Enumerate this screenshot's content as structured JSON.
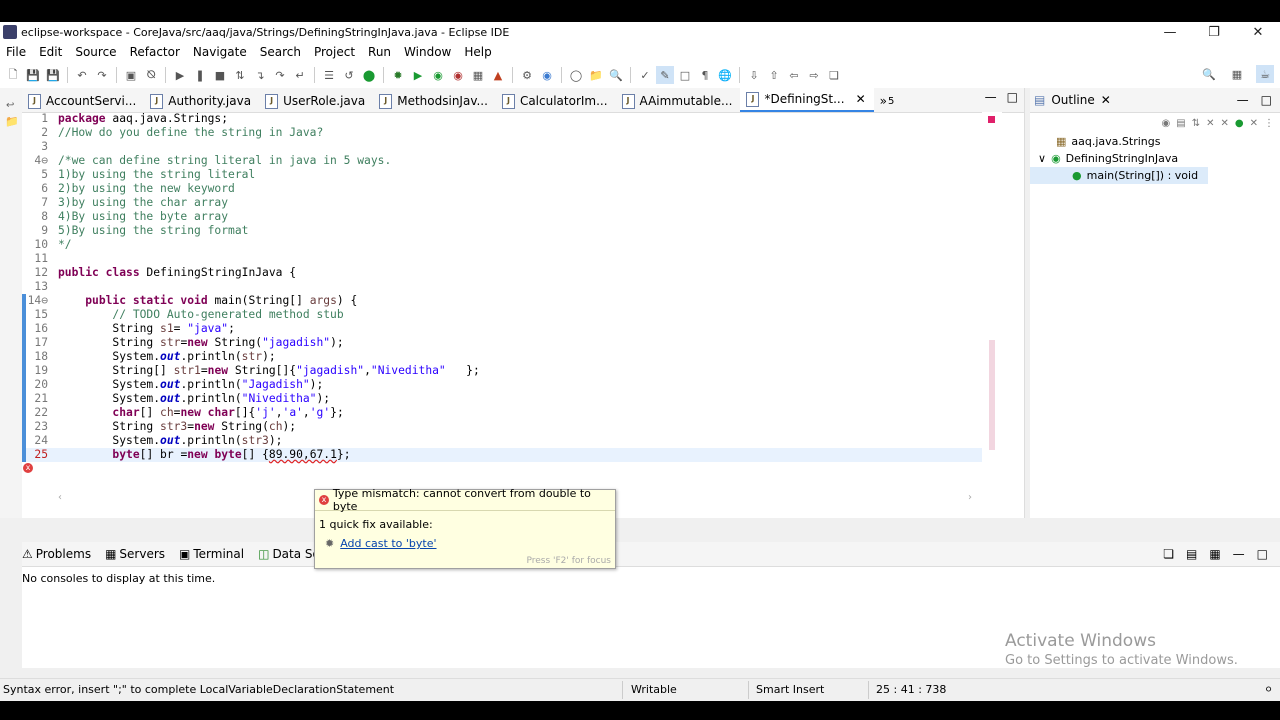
{
  "window": {
    "title": "eclipse-workspace - CoreJava/src/aaq/java/Strings/DefiningStringInJava.java - Eclipse IDE"
  },
  "menu": [
    "File",
    "Edit",
    "Source",
    "Refactor",
    "Navigate",
    "Search",
    "Project",
    "Run",
    "Window",
    "Help"
  ],
  "tabs": [
    "AccountServi...",
    "Authority.java",
    "UserRole.java",
    "MethodsinJav...",
    "CalculatorIm...",
    "AAimmutable...",
    "*DefiningSt..."
  ],
  "tab_overflow": "5",
  "code": [
    {
      "n": "1",
      "t": "package aaq.java.Strings;"
    },
    {
      "n": "2",
      "t": "//How do you define the string in Java?"
    },
    {
      "n": "3",
      "t": ""
    },
    {
      "n": "4⊖",
      "t": "/*we can define string literal in java in 5 ways."
    },
    {
      "n": "5",
      "t": "1)by using the string literal"
    },
    {
      "n": "6",
      "t": "2)by using the new keyword"
    },
    {
      "n": "7",
      "t": "3)by using the char array"
    },
    {
      "n": "8",
      "t": "4)By using the byte array"
    },
    {
      "n": "9",
      "t": "5)By using the string format"
    },
    {
      "n": "10",
      "t": "*/"
    },
    {
      "n": "11",
      "t": ""
    },
    {
      "n": "12",
      "t": "public class DefiningStringInJava {"
    },
    {
      "n": "13",
      "t": ""
    },
    {
      "n": "14⊖",
      "t": "    public static void main(String[] args) {"
    },
    {
      "n": "15",
      "t": "        // TODO Auto-generated method stub"
    },
    {
      "n": "16",
      "t": "        String s1= \"java\";"
    },
    {
      "n": "17",
      "t": "        String str=new String(\"jagadish\");"
    },
    {
      "n": "18",
      "t": "        System.out.println(str);"
    },
    {
      "n": "19",
      "t": "        String[] str1=new String[]{\"jagadish\",\"Niveditha\"   };"
    },
    {
      "n": "20",
      "t": "        System.out.println(\"Jagadish\");"
    },
    {
      "n": "21",
      "t": "        System.out.println(\"Niveditha\");"
    },
    {
      "n": "22",
      "t": "        char[] ch=new char[]{'j','a','g'};"
    },
    {
      "n": "23",
      "t": "        String str3=new String(ch);"
    },
    {
      "n": "24",
      "t": "        System.out.println(str3);"
    },
    {
      "n": "25",
      "t": "        byte[] br =new byte[] {89.90,67.1};"
    }
  ],
  "tooltip": {
    "error": "Type mismatch: cannot convert from double to byte",
    "count": "1 quick fix available:",
    "fix": "Add cast to 'byte'",
    "hint": "Press 'F2' for focus"
  },
  "outline": {
    "title": "Outline",
    "package": "aaq.java.Strings",
    "class": "DefiningStringInJava",
    "method": "main(String[]) : void"
  },
  "bottom": {
    "tabs": [
      "Problems",
      "Servers",
      "Terminal",
      "Data Source"
    ],
    "message": "No consoles to display at this time."
  },
  "watermark": {
    "line1": "Activate Windows",
    "line2": "Go to Settings to activate Windows."
  },
  "status": {
    "message": "Syntax error, insert \";\" to complete LocalVariableDeclarationStatement",
    "mode": "Writable",
    "insert": "Smart Insert",
    "position": "25 : 41 : 738"
  }
}
